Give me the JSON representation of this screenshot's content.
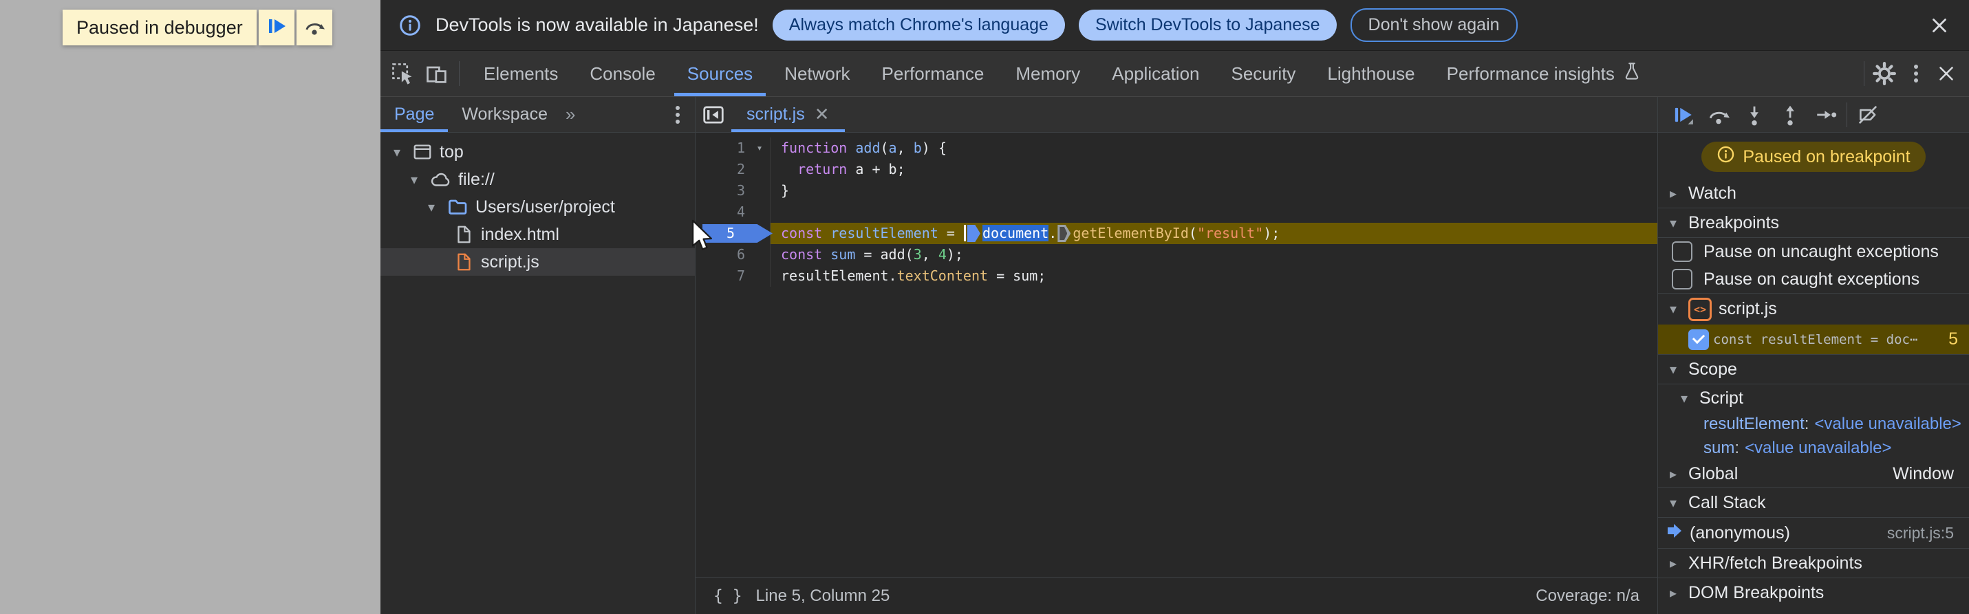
{
  "colors": {
    "accent_blue": "#7cacf8",
    "icon_blue": "#669df6",
    "paused_yellow": "#fdd663",
    "exec_line_bg": "#6b5900",
    "selection_blue": "#2a6ad2",
    "page_gray": "#b1b1b1",
    "pill_bg": "#a8c7fa",
    "breakpoint_flag": "#4e7fe0",
    "file_js_orange": "#ee8445"
  },
  "icons": {
    "twisty_open": "▾",
    "twisty_closed": "▸",
    "overflow_chevron": "»",
    "braces_glyph": "{ }",
    "code_badge_glyph": "<>",
    "close_glyph": "✕"
  },
  "page": {
    "paused_banner_label": "Paused in debugger"
  },
  "notification": {
    "message": "DevTools is now available in Japanese!",
    "primary_button": "Always match Chrome's language",
    "secondary_button": "Switch DevTools to Japanese",
    "dismiss_button": "Don't show again"
  },
  "main_tabs": {
    "items": [
      "Elements",
      "Console",
      "Sources",
      "Network",
      "Performance",
      "Memory",
      "Application",
      "Security",
      "Lighthouse",
      "Performance insights"
    ],
    "selected": "Sources"
  },
  "navigator": {
    "page_tab": "Page",
    "workspace_tab": "Workspace",
    "tree": [
      {
        "label": "top"
      },
      {
        "label": "file://"
      },
      {
        "label": "Users/user/project"
      },
      {
        "label": "index.html"
      },
      {
        "label": "script.js"
      }
    ]
  },
  "editor": {
    "tab_title": "script.js",
    "lines": [
      {
        "num": "1",
        "fold": true,
        "tokens": [
          {
            "t": "function",
            "c": "kw"
          },
          {
            "t": " ",
            "c": "pl"
          },
          {
            "t": "add",
            "c": "def"
          },
          {
            "t": "(",
            "c": "pl"
          },
          {
            "t": "a",
            "c": "def"
          },
          {
            "t": ", ",
            "c": "pl"
          },
          {
            "t": "b",
            "c": "def"
          },
          {
            "t": ") {",
            "c": "pl"
          }
        ]
      },
      {
        "num": "2",
        "tokens": [
          {
            "t": "  ",
            "c": "pl"
          },
          {
            "t": "return",
            "c": "kw"
          },
          {
            "t": " a + b;",
            "c": "pl"
          }
        ]
      },
      {
        "num": "3",
        "tokens": [
          {
            "t": "}",
            "c": "pl"
          }
        ]
      },
      {
        "num": "4",
        "tokens": []
      },
      {
        "num": "5",
        "exec": true,
        "tokens": [
          {
            "t": "const",
            "c": "kw"
          },
          {
            "t": " ",
            "c": "pl"
          },
          {
            "t": "resultElement",
            "c": "var"
          },
          {
            "t": " = ",
            "c": "pl"
          },
          {
            "marker": "text-caret"
          },
          {
            "marker": "continue-marker-active"
          },
          {
            "t": "document",
            "c": "sel"
          },
          {
            "t": ".",
            "c": "pl"
          },
          {
            "marker": "continue-marker"
          },
          {
            "t": "getElementById",
            "c": "prop"
          },
          {
            "t": "(",
            "c": "pl"
          },
          {
            "t": "\"result\"",
            "c": "str"
          },
          {
            "t": ");",
            "c": "pl"
          }
        ]
      },
      {
        "num": "6",
        "tokens": [
          {
            "t": "const",
            "c": "kw"
          },
          {
            "t": " ",
            "c": "pl"
          },
          {
            "t": "sum",
            "c": "var"
          },
          {
            "t": " = add(",
            "c": "pl"
          },
          {
            "t": "3",
            "c": "num"
          },
          {
            "t": ", ",
            "c": "pl"
          },
          {
            "t": "4",
            "c": "num"
          },
          {
            "t": ");",
            "c": "pl"
          }
        ]
      },
      {
        "num": "7",
        "tokens": [
          {
            "t": "resultElement.",
            "c": "pl"
          },
          {
            "t": "textContent",
            "c": "prop"
          },
          {
            "t": " = sum;",
            "c": "pl"
          }
        ]
      }
    ],
    "status": {
      "line_col": "Line 5, Column 25",
      "coverage": "Coverage: n/a"
    }
  },
  "debugger": {
    "paused_badge": "Paused on breakpoint",
    "watch_title": "Watch",
    "breakpoints": {
      "title": "Breakpoints",
      "pause_uncaught": "Pause on uncaught exceptions",
      "pause_caught": "Pause on caught exceptions",
      "file": "script.js",
      "entry_label": "const resultElement = doc⋯",
      "entry_line": "5"
    },
    "scope": {
      "title": "Scope",
      "group": "Script",
      "vars": [
        {
          "name": "resultElement",
          "value": "<value unavailable>"
        },
        {
          "name": "sum",
          "value": "<value unavailable>"
        }
      ],
      "global_label": "Global",
      "global_value": "Window"
    },
    "call_stack": {
      "title": "Call Stack",
      "frame": "(anonymous)",
      "location": "script.js:5"
    },
    "xhr_title": "XHR/fetch Breakpoints",
    "dom_title": "DOM Breakpoints"
  }
}
